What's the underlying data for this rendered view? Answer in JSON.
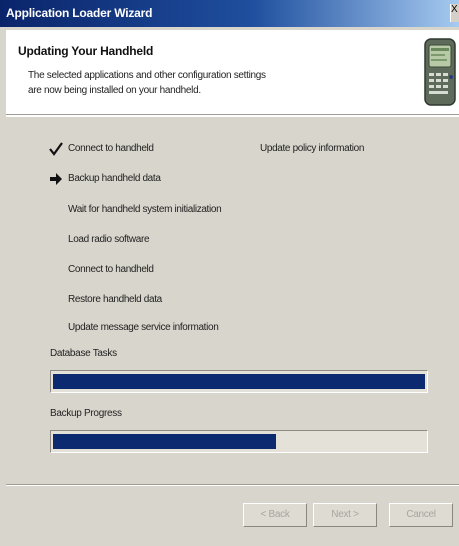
{
  "window": {
    "title": "Application Loader Wizard",
    "close_glyph": "X"
  },
  "header": {
    "title": "Updating Your Handheld",
    "subtitle_line1": "The selected applications and other configuration settings",
    "subtitle_line2": "are now being installed on your handheld.",
    "icon": "handheld-device-icon"
  },
  "steps": [
    {
      "label": "Connect to handheld",
      "state": "done",
      "icon": "checkmark-icon"
    },
    {
      "label": "Backup handheld data",
      "state": "current",
      "icon": "arrow-right-icon"
    },
    {
      "label": "Wait for handheld system initialization",
      "state": "pending"
    },
    {
      "label": "Load radio software",
      "state": "pending"
    },
    {
      "label": "Connect to handheld",
      "state": "pending"
    },
    {
      "label": "Restore handheld data",
      "state": "pending"
    },
    {
      "label": "Update message service information",
      "state": "pending"
    }
  ],
  "side_step": {
    "label": "Update policy information"
  },
  "progress": {
    "database_label": "Database Tasks",
    "database_fraction": 1.0,
    "backup_label": "Backup Progress",
    "backup_fraction": 0.6
  },
  "buttons": {
    "back": "< Back",
    "next": "Next >",
    "cancel": "Cancel"
  },
  "colors": {
    "title_bar": "#0a246a",
    "progress_fill": "#0b2a6f",
    "dialog_bg": "#d8d5cc"
  }
}
